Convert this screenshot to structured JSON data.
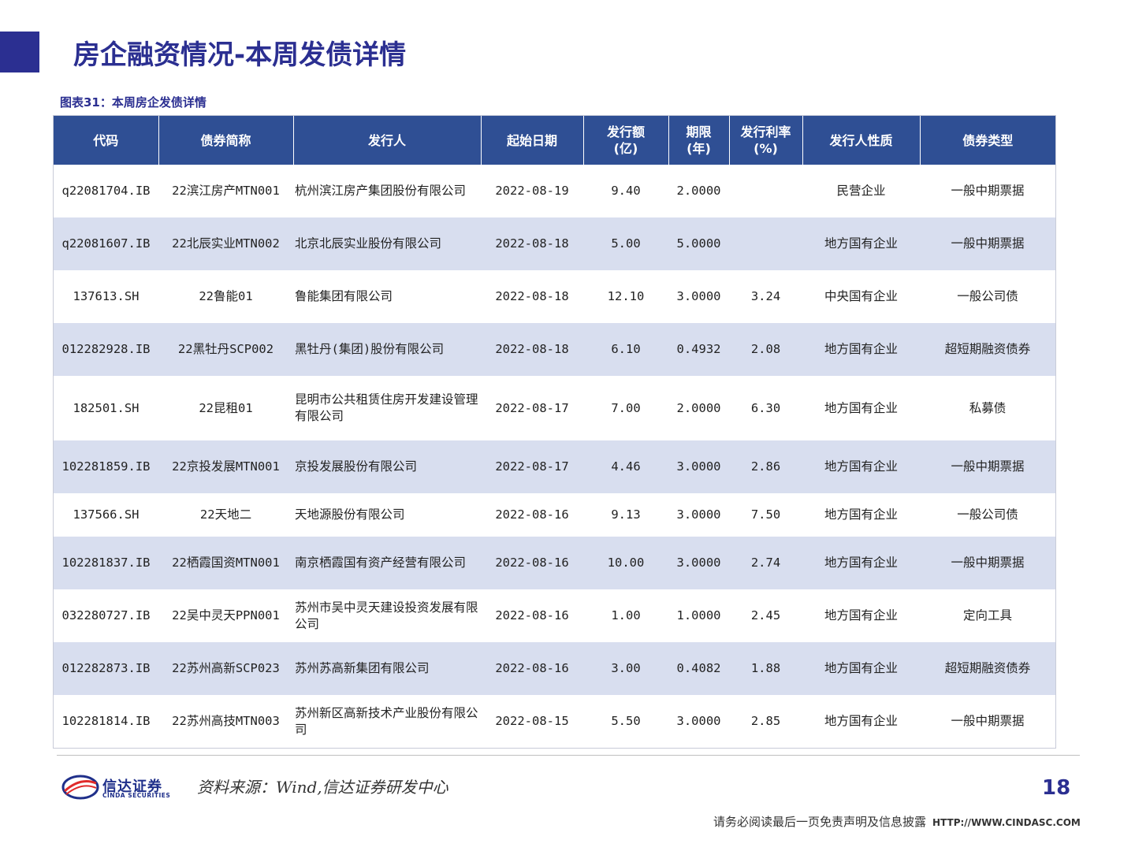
{
  "header": {
    "title": "房企融资情况-本周发债详情"
  },
  "figure": {
    "caption": "图表31：本周房企发债详情"
  },
  "table": {
    "columns": [
      "代码",
      "债券简称",
      "发行人",
      "起始日期",
      "发行额\n(亿)",
      "期限\n(年)",
      "发行利率\n(%)",
      "发行人性质",
      "债券类型"
    ],
    "rows": [
      [
        "q22081704.IB",
        "22滨江房产MTN001",
        "杭州滨江房产集团股份有限公司",
        "2022-08-19",
        "9.40",
        "2.0000",
        "",
        "民营企业",
        "一般中期票据"
      ],
      [
        "q22081607.IB",
        "22北辰实业MTN002",
        "北京北辰实业股份有限公司",
        "2022-08-18",
        "5.00",
        "5.0000",
        "",
        "地方国有企业",
        "一般中期票据"
      ],
      [
        "137613.SH",
        "22鲁能01",
        "鲁能集团有限公司",
        "2022-08-18",
        "12.10",
        "3.0000",
        "3.24",
        "中央国有企业",
        "一般公司债"
      ],
      [
        "012282928.IB",
        "22黑牡丹SCP002",
        "黑牡丹(集团)股份有限公司",
        "2022-08-18",
        "6.10",
        "0.4932",
        "2.08",
        "地方国有企业",
        "超短期融资债券"
      ],
      [
        "182501.SH",
        "22昆租01",
        "昆明市公共租赁住房开发建设管理有限公司",
        "2022-08-17",
        "7.00",
        "2.0000",
        "6.30",
        "地方国有企业",
        "私募债"
      ],
      [
        "102281859.IB",
        "22京投发展MTN001",
        "京投发展股份有限公司",
        "2022-08-17",
        "4.46",
        "3.0000",
        "2.86",
        "地方国有企业",
        "一般中期票据"
      ],
      [
        "137566.SH",
        "22天地二",
        "天地源股份有限公司",
        "2022-08-16",
        "9.13",
        "3.0000",
        "7.50",
        "地方国有企业",
        "一般公司债"
      ],
      [
        "102281837.IB",
        "22栖霞国资MTN001",
        "南京栖霞国有资产经营有限公司",
        "2022-08-16",
        "10.00",
        "3.0000",
        "2.74",
        "地方国有企业",
        "一般中期票据"
      ],
      [
        "032280727.IB",
        "22吴中灵天PPN001",
        "苏州市吴中灵天建设投资发展有限公司",
        "2022-08-16",
        "1.00",
        "1.0000",
        "2.45",
        "地方国有企业",
        "定向工具"
      ],
      [
        "012282873.IB",
        "22苏州高新SCP023",
        "苏州苏高新集团有限公司",
        "2022-08-16",
        "3.00",
        "0.4082",
        "1.88",
        "地方国有企业",
        "超短期融资债券"
      ],
      [
        "102281814.IB",
        "22苏州高技MTN003",
        "苏州新区高新技术产业股份有限公司",
        "2022-08-15",
        "5.50",
        "3.0000",
        "2.85",
        "地方国有企业",
        "一般中期票据"
      ]
    ]
  },
  "footer": {
    "logo_cn": "信达证券",
    "logo_en": "CINDA SECURITIES",
    "source": "资料来源：Wind,信达证券研发中心",
    "page_number": "18",
    "disclaimer": "请务必阅读最后一页免责声明及信息披露",
    "url": "HTTP://WWW.CINDASC.COM"
  },
  "colors": {
    "brand": "#2b2f91",
    "header_bg": "#2f4f94",
    "row_alt": "#d8deef"
  }
}
